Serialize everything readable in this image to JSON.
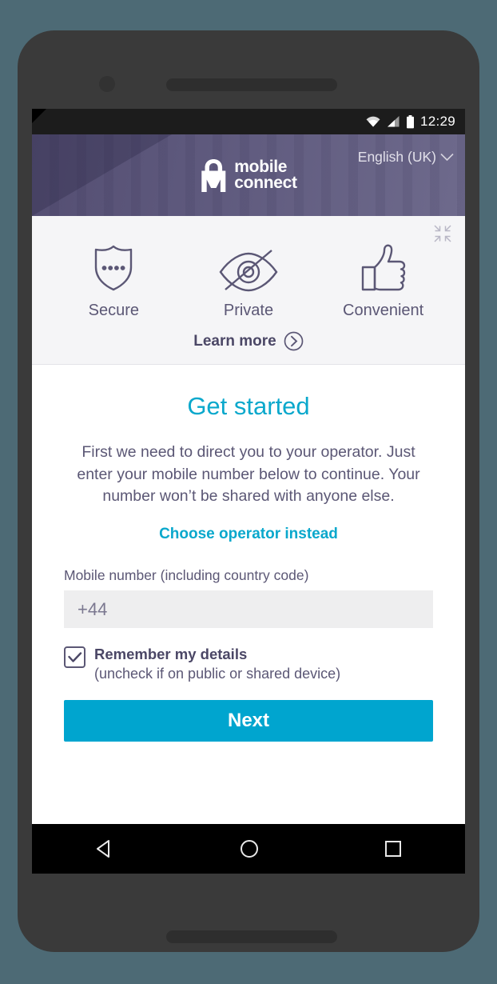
{
  "status_bar": {
    "clock": "12:29",
    "icons": [
      "wifi-icon",
      "signal-icon",
      "battery-icon"
    ]
  },
  "header": {
    "logo": {
      "icon": "padlock-m-logo",
      "line1": "mobile",
      "line2": "connect"
    },
    "language": {
      "label": "English (UK)",
      "chevron": "chevron-down-icon"
    },
    "colors": {
      "gradient_start": "#544e72",
      "gradient_end": "#6e6a8c"
    }
  },
  "features": {
    "collapse_icon": "collapse-arrows-icon",
    "items": [
      {
        "icon": "shield-dots-icon",
        "label": "Secure"
      },
      {
        "icon": "eye-slash-icon",
        "label": "Private"
      },
      {
        "icon": "thumbs-up-icon",
        "label": "Convenient"
      }
    ],
    "learn_more": {
      "label": "Learn more",
      "icon": "chevron-right-circle-icon"
    }
  },
  "main": {
    "title": "Get started",
    "intro": "First we need to direct you to your operator. Just enter your mobile number below to continue. Your number won’t be shared with anyone else.",
    "operator_link": "Choose operator instead",
    "field": {
      "label": "Mobile number (including country code)",
      "value": "+44",
      "placeholder": "+44"
    },
    "remember": {
      "checked": true,
      "title": "Remember my details",
      "subtitle": "(uncheck if on public or shared device)"
    },
    "next_button": "Next",
    "colors": {
      "accent": "#0aa8cc",
      "button": "#00a5cf",
      "text": "#5b5775"
    }
  },
  "nav_bar": {
    "back": "back-triangle-icon",
    "home": "home-circle-icon",
    "recents": "recents-square-icon"
  }
}
